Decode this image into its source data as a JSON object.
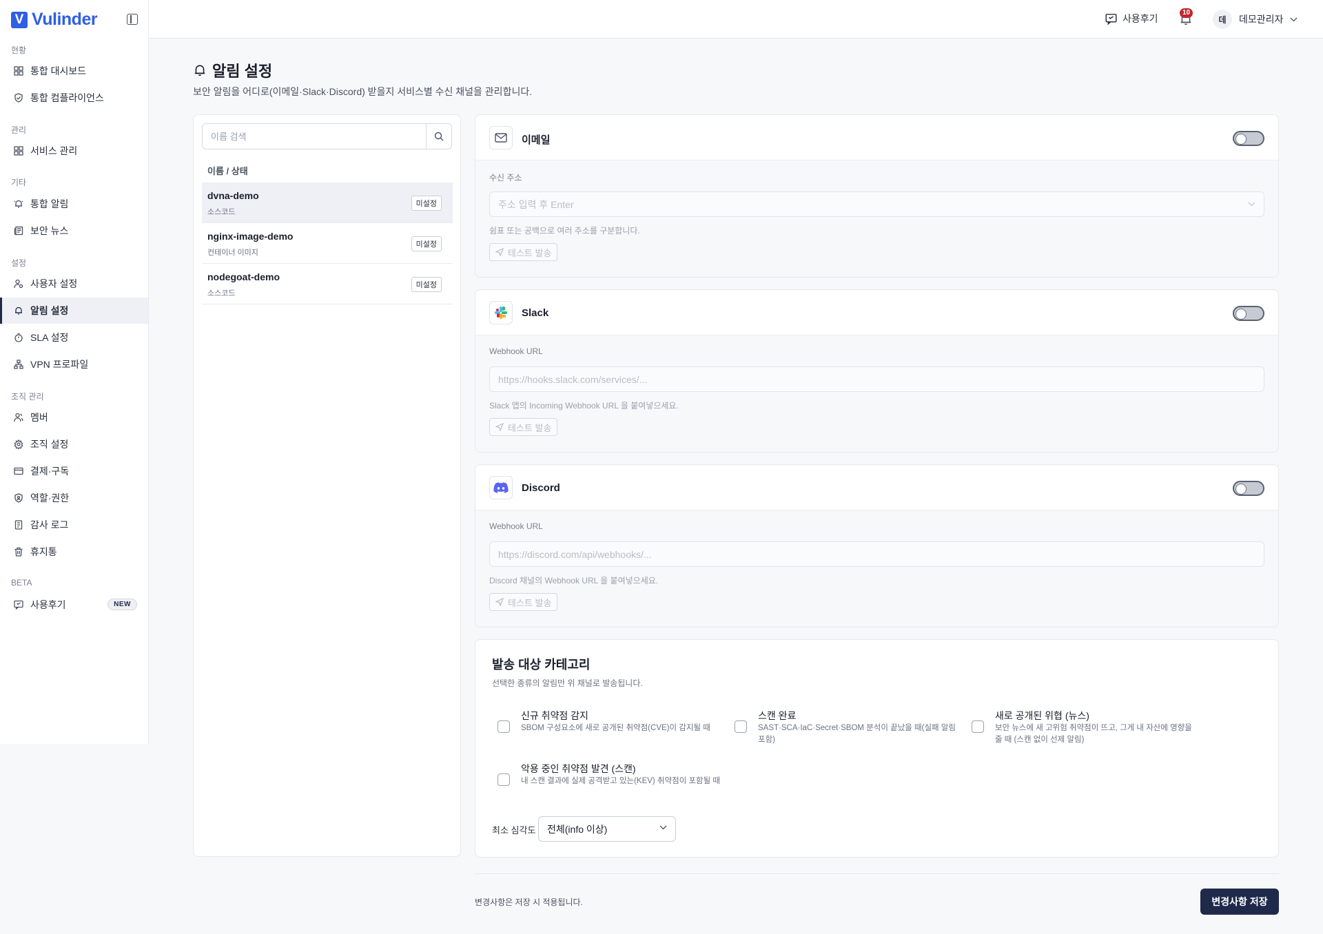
{
  "app": {
    "logo_letter": "V",
    "logo_text": "Vulinder",
    "brand_color": "#2f5fe3"
  },
  "sidebar": {
    "sections": [
      {
        "label": "현황"
      },
      {
        "label": "관리"
      },
      {
        "label": "기타"
      },
      {
        "label": "설정"
      },
      {
        "label": "조직 관리"
      },
      {
        "label": "BETA"
      }
    ],
    "items": [
      {
        "label": "통합 대시보드",
        "icon": "grid-icon"
      },
      {
        "label": "통합 컴플라이언스",
        "icon": "shield-check-icon"
      },
      {
        "label": "서비스 관리",
        "icon": "grid-icon"
      },
      {
        "label": "통합 알림",
        "icon": "bell-ring-icon"
      },
      {
        "label": "보안 뉴스",
        "icon": "newspaper-icon"
      },
      {
        "label": "사용자 설정",
        "icon": "user-gear-icon"
      },
      {
        "label": "알림 설정",
        "icon": "bell-icon",
        "active": true
      },
      {
        "label": "SLA 설정",
        "icon": "timer-icon"
      },
      {
        "label": "VPN 프로파일",
        "icon": "network-icon"
      },
      {
        "label": "멤버",
        "icon": "users-icon"
      },
      {
        "label": "조직 설정",
        "icon": "gear-icon"
      },
      {
        "label": "결제·구독",
        "icon": "credit-card-icon"
      },
      {
        "label": "역할·권한",
        "icon": "shield-user-icon"
      },
      {
        "label": "감사 로그",
        "icon": "log-icon"
      },
      {
        "label": "휴지통",
        "icon": "trash-icon"
      },
      {
        "label": "사용후기",
        "icon": "message-icon",
        "badge": "NEW"
      }
    ]
  },
  "topbar": {
    "review_label": "사용후기",
    "notification_count": "10",
    "avatar_initial": "데",
    "user_name": "데모관리자"
  },
  "page": {
    "title": "알림 설정",
    "subtitle": "보안 알림을 어디로(이메일·Slack·Discord) 받을지 서비스별 수신 채널을 관리합니다."
  },
  "service_list": {
    "search_placeholder": "이름 검색",
    "header": "이름 / 상태",
    "rows": [
      {
        "name": "dvna-demo",
        "type": "소스코드",
        "status": "미설정",
        "selected": true
      },
      {
        "name": "nginx-image-demo",
        "type": "컨테이너 이미지",
        "status": "미설정"
      },
      {
        "name": "nodegoat-demo",
        "type": "소스코드",
        "status": "미설정"
      }
    ]
  },
  "channels": [
    {
      "key": "email",
      "title": "이메일",
      "enabled": false,
      "field_label": "수신 주소",
      "placeholder": "주소 입력 후 Enter",
      "hint": "쉼표 또는 공백으로 여러 주소를 구분합니다.",
      "test_label": "테스트 발송"
    },
    {
      "key": "slack",
      "title": "Slack",
      "enabled": false,
      "field_label": "Webhook URL",
      "placeholder": "https://hooks.slack.com/services/...",
      "hint": "Slack 앱의 Incoming Webhook URL 을 붙여넣으세요.",
      "test_label": "테스트 발송"
    },
    {
      "key": "discord",
      "title": "Discord",
      "enabled": false,
      "field_label": "Webhook URL",
      "placeholder": "https://discord.com/api/webhooks/...",
      "hint": "Discord 채널의 Webhook URL 을 붙여넣으세요.",
      "test_label": "테스트 발송"
    }
  ],
  "categories": {
    "title": "발송 대상 카테고리",
    "subtitle": "선택한 종류의 알림만 위 채널로 발송됩니다.",
    "options": [
      {
        "name": "신규 취약점 감지",
        "desc": "SBOM 구성요소에 새로 공개된 취약점(CVE)이 감지될 때",
        "checked": false
      },
      {
        "name": "스캔 완료",
        "desc": "SAST·SCA·IaC·Secret·SBOM 분석이 끝났을 때(실패 알림 포함)",
        "checked": false
      },
      {
        "name": "새로 공개된 위협 (뉴스)",
        "desc": "보안 뉴스에 새 고위험 취약점이 뜨고, 그게 내 자산에 영향을 줄 때 (스캔 없이 선제 알림)",
        "checked": false
      },
      {
        "name": "악용 중인 취약점 발견 (스캔)",
        "desc": "내 스캔 결과에 실제 공격받고 있는(KEV) 취약점이 포함될 때",
        "checked": false
      }
    ],
    "severity_label": "최소 심각도",
    "severity_value": "전체(info 이상)"
  },
  "footer": {
    "note": "변경사항은 저장 시 적용됩니다.",
    "save_label": "변경사항 저장"
  }
}
